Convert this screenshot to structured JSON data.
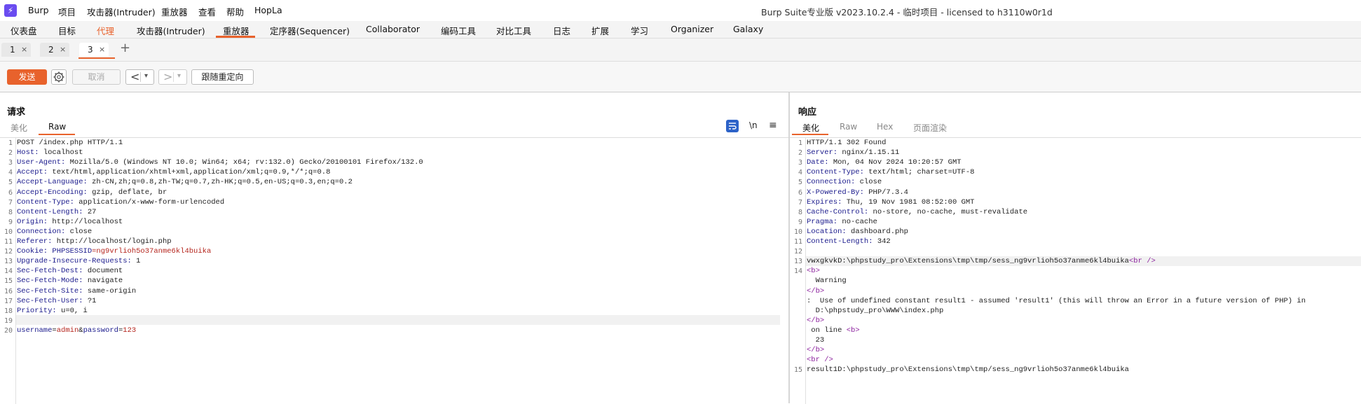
{
  "menubar": {
    "logo_glyph": "⚡",
    "items": [
      "Burp",
      "项目",
      "攻击器(Intruder)",
      "重放器",
      "查看",
      "帮助",
      "HopLa"
    ],
    "title": "Burp Suite专业版  v2023.10.2.4 - 临时项目 - licensed to h3110w0r1d"
  },
  "tooltabs": {
    "items": [
      "仪表盘",
      "目标",
      "代理",
      "攻击器(Intruder)",
      "重放器",
      "定序器(Sequencer)",
      "Collaborator",
      "编码工具",
      "对比工具",
      "日志",
      "扩展",
      "学习",
      "Organizer",
      "Galaxy"
    ],
    "active": "重放器",
    "accent_color": "#e8622c"
  },
  "repeater_tabs": {
    "tabs": [
      {
        "num": "1",
        "close": "×"
      },
      {
        "num": "2",
        "close": "×"
      },
      {
        "num": "3",
        "close": "×"
      }
    ],
    "add": "+"
  },
  "toolbar": {
    "send_label": "发送",
    "cancel_label": "取消",
    "back_glyph": "<",
    "fwd_glyph": ">",
    "dropdown_glyph": "▾",
    "follow_label": "跟随重定向"
  },
  "request": {
    "title": "请求",
    "subtabs": [
      "美化",
      "Raw"
    ],
    "selected_subtab": "Raw",
    "newline_label": "\\n",
    "menu_glyph": "≡",
    "lines": [
      {
        "n": "1",
        "text": "POST /index.php HTTP/1.1"
      },
      {
        "n": "2",
        "name": "Host:",
        "value": " localhost"
      },
      {
        "n": "3",
        "name": "User-Agent:",
        "value": " Mozilla/5.0 (Windows NT 10.0; Win64; x64; rv:132.0) Gecko/20100101 Firefox/132.0"
      },
      {
        "n": "4",
        "name": "Accept:",
        "value": " text/html,application/xhtml+xml,application/xml;q=0.9,*/*;q=0.8"
      },
      {
        "n": "5",
        "name": "Accept-Language:",
        "value": " zh-CN,zh;q=0.8,zh-TW;q=0.7,zh-HK;q=0.5,en-US;q=0.3,en;q=0.2"
      },
      {
        "n": "6",
        "name": "Accept-Encoding:",
        "value": " gzip, deflate, br"
      },
      {
        "n": "7",
        "name": "Content-Type:",
        "value": " application/x-www-form-urlencoded"
      },
      {
        "n": "8",
        "name": "Content-Length:",
        "value": " 27"
      },
      {
        "n": "9",
        "name": "Origin:",
        "value": " http://localhost"
      },
      {
        "n": "10",
        "name": "Connection:",
        "value": " close"
      },
      {
        "n": "11",
        "name": "Referer:",
        "value": " http://localhost/login.php"
      },
      {
        "n": "12",
        "name": "Cookie:",
        "cookie_name": " PHPSESSID",
        "cookie_value": "=ng9vrlioh5o37anme6kl4buika"
      },
      {
        "n": "13",
        "name": "Upgrade-Insecure-Requests:",
        "value": " 1"
      },
      {
        "n": "14",
        "name": "Sec-Fetch-Dest:",
        "value": " document"
      },
      {
        "n": "15",
        "name": "Sec-Fetch-Mode:",
        "value": " navigate"
      },
      {
        "n": "16",
        "name": "Sec-Fetch-Site:",
        "value": " same-origin"
      },
      {
        "n": "17",
        "name": "Sec-Fetch-User:",
        "value": " ?1"
      },
      {
        "n": "18",
        "name": "Priority:",
        "value": " u=0, i"
      },
      {
        "n": "19",
        "text": ""
      },
      {
        "n": "20",
        "body": {
          "k1": "username",
          "v1": "admin",
          "k2": "password",
          "v2": "123"
        }
      }
    ]
  },
  "response": {
    "title": "响应",
    "subtabs": [
      "美化",
      "Raw",
      "Hex",
      "页面渲染"
    ],
    "selected_subtab": "美化",
    "lines": [
      {
        "n": "1",
        "text": "HTTP/1.1 302 Found"
      },
      {
        "n": "2",
        "name": "Server:",
        "value": " nginx/1.15.11"
      },
      {
        "n": "3",
        "name": "Date:",
        "value": " Mon, 04 Nov 2024 10:20:57 GMT"
      },
      {
        "n": "4",
        "name": "Content-Type:",
        "value": " text/html; charset=UTF-8"
      },
      {
        "n": "5",
        "name": "Connection:",
        "value": " close"
      },
      {
        "n": "6",
        "name": "X-Powered-By:",
        "value": " PHP/7.3.4"
      },
      {
        "n": "7",
        "name": "Expires:",
        "value": " Thu, 19 Nov 1981 08:52:00 GMT"
      },
      {
        "n": "8",
        "name": "Cache-Control:",
        "value": " no-store, no-cache, must-revalidate"
      },
      {
        "n": "9",
        "name": "Pragma:",
        "value": " no-cache"
      },
      {
        "n": "10",
        "name": "Location:",
        "value": " dashboard.php"
      },
      {
        "n": "11",
        "name": "Content-Length:",
        "value": " 342"
      },
      {
        "n": "12",
        "text": ""
      },
      {
        "n": "13",
        "text": "vwxgkvkD:\\phpstudy_pro\\Extensions\\tmp\\tmp/sess_ng9vrlioh5o37anme6kl4buika",
        "tag": "<br />"
      },
      {
        "n": "14",
        "tag": "<b>"
      },
      {
        "n": "",
        "text": "  Warning"
      },
      {
        "n": "",
        "tag": "</b>"
      },
      {
        "n": "",
        "text": ":  Use of undefined constant result1 - assumed 'result1' (this will throw an Error in a future version of PHP) in"
      },
      {
        "n": "",
        "text": "  D:\\phpstudy_pro\\WWW\\index.php"
      },
      {
        "n": "",
        "tag": "</b>"
      },
      {
        "n": "",
        "text": " on line ",
        "tag": "<b>"
      },
      {
        "n": "",
        "text": "  23"
      },
      {
        "n": "",
        "tag": "</b>"
      },
      {
        "n": "",
        "tag": "<br />"
      },
      {
        "n": "15",
        "text": "result1D:\\phpstudy_pro\\Extensions\\tmp\\tmp/sess_ng9vrlioh5o37anme6kl4buika"
      }
    ]
  }
}
